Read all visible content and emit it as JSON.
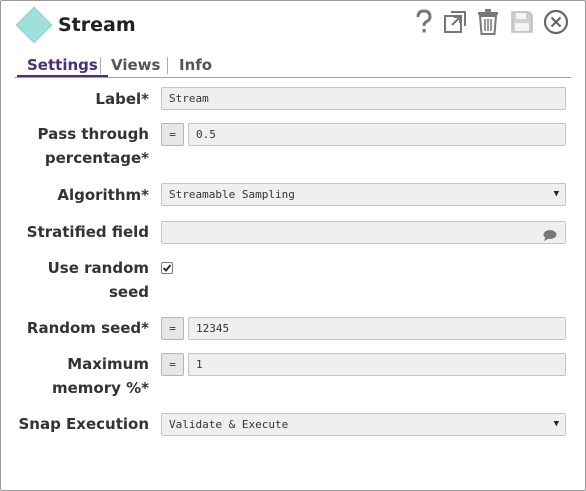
{
  "header": {
    "title": "Stream",
    "icons": [
      "help-icon",
      "export-icon",
      "delete-icon",
      "save-icon",
      "close-icon"
    ]
  },
  "tabs": [
    {
      "label": "Settings",
      "active": true
    },
    {
      "label": "Views",
      "active": false
    },
    {
      "label": "Info",
      "active": false
    }
  ],
  "form": {
    "label": {
      "label": "Label*",
      "value": "Stream"
    },
    "pass_through": {
      "label_line1": "Pass through",
      "label_line2": "percentage*",
      "expr_toggle": "=",
      "value": "0.5"
    },
    "algorithm": {
      "label": "Algorithm*",
      "value": "Streamable Sampling"
    },
    "stratified": {
      "label": "Stratified field",
      "value": ""
    },
    "use_random_seed": {
      "label_line1": "Use random",
      "label_line2": "seed",
      "checked": true
    },
    "random_seed": {
      "label": "Random seed*",
      "expr_toggle": "=",
      "value": "12345"
    },
    "max_memory": {
      "label_line1": "Maximum",
      "label_line2": "memory %*",
      "expr_toggle": "=",
      "value": "1"
    },
    "snap_execution": {
      "label": "Snap Execution",
      "value": "Validate & Execute"
    }
  },
  "colors": {
    "accent": "#4b2d7a",
    "icon": "#9fe0dd"
  }
}
